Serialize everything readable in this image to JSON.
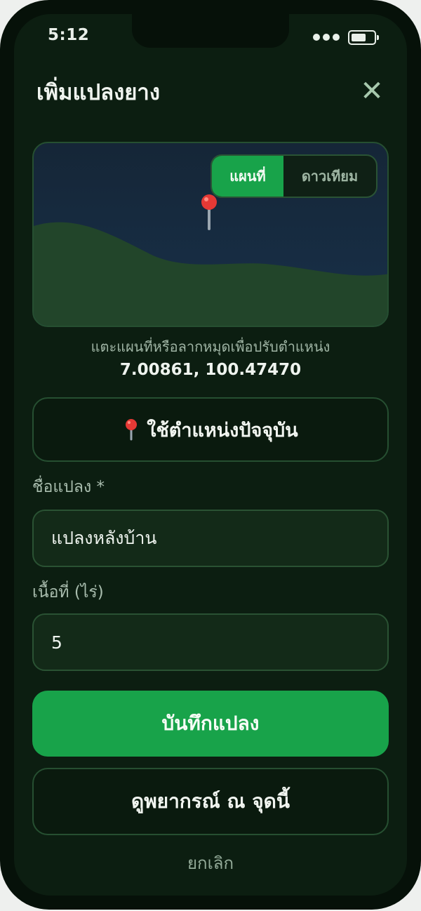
{
  "status_bar": {
    "time": "5:12"
  },
  "header": {
    "title": "เพิ่มแปลงยาง",
    "close_symbol": "✕"
  },
  "map": {
    "toggle": [
      {
        "label": "แผนที่",
        "active": true
      },
      {
        "label": "ดาวเทียม",
        "active": false
      }
    ],
    "hint": "แตะแผนที่หรือลากหมุดเพื่อปรับตำแหน่ง",
    "coordinates": "7.00861, 100.47470"
  },
  "location_button": {
    "label": "ใช้ตำแหน่งปัจจุบัน",
    "icon": "map-pin-icon"
  },
  "form": {
    "name_label": "ชื่อแปลง *",
    "name_value": "แปลงหลังบ้าน",
    "area_label": "เนื้อที่ (ไร่)",
    "area_value": "5"
  },
  "actions": {
    "save_label": "บันทึกแปลง",
    "forecast_label": "ดูพยากรณ์ ณ จุดนี้",
    "cancel_label": "ยกเลิก"
  },
  "colors": {
    "background": "#0c1e11",
    "accent": "#18a34a",
    "border": "#264f31",
    "pin": "#e53935"
  }
}
